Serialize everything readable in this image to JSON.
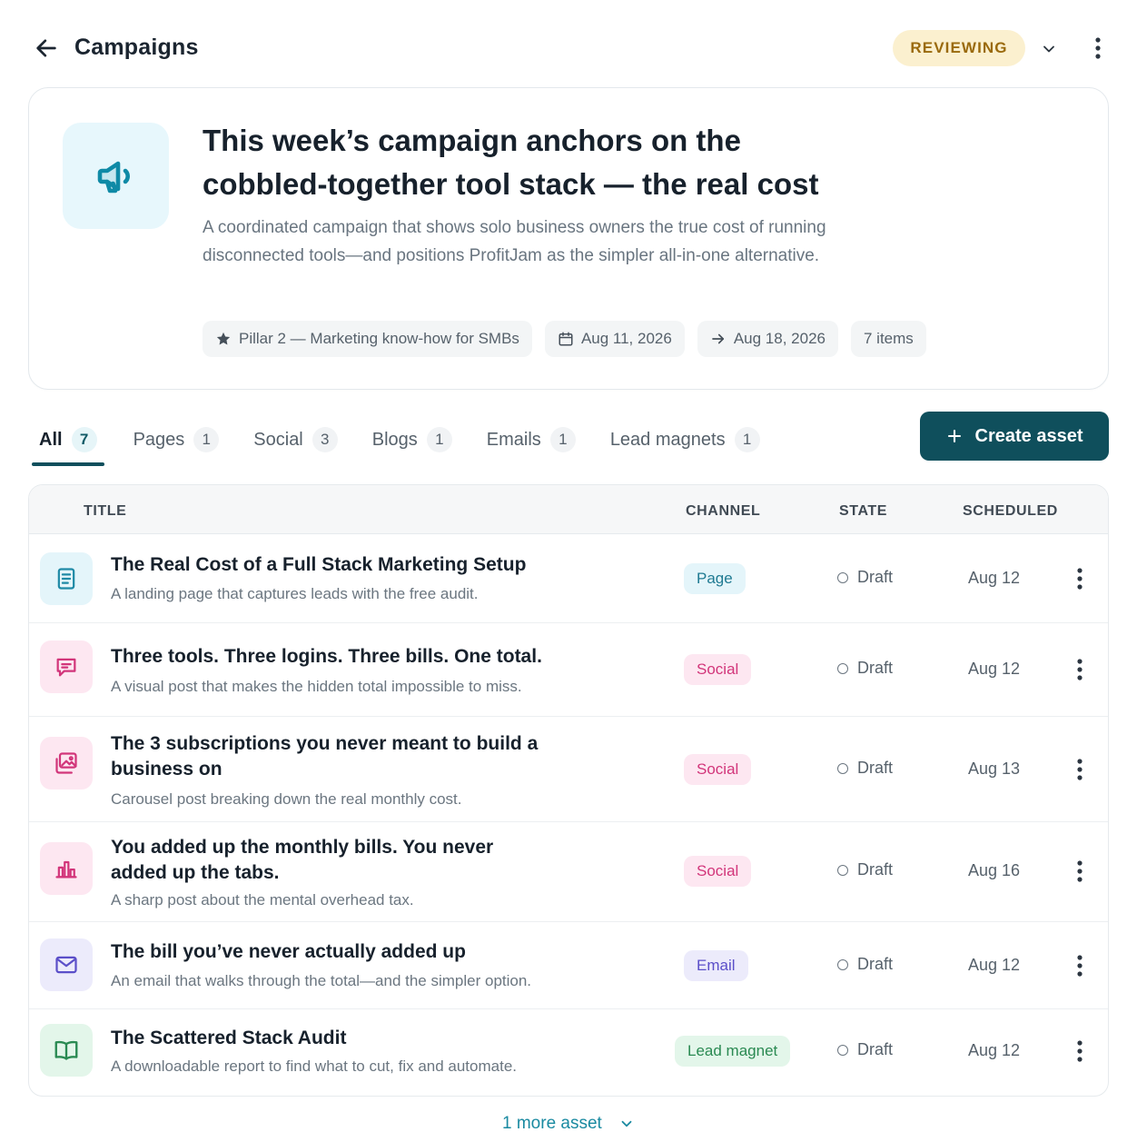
{
  "header": {
    "title": "Campaigns",
    "status": "REVIEWING"
  },
  "campaign": {
    "heading": "This week’s campaign anchors on the cobbled-together tool stack — the real cost",
    "description": "A coordinated campaign that shows solo business owners the true cost of running disconnected tools—and positions ProfitJam as the simpler all-in-one alternative.",
    "chips": {
      "pillar": "Pillar 2 — Marketing know-how for SMBs",
      "start_date": "Aug 11, 2026",
      "end_date": "Aug 18, 2026",
      "items": "7 items"
    }
  },
  "tabs": [
    {
      "label": "All",
      "count": "7"
    },
    {
      "label": "Pages",
      "count": "1"
    },
    {
      "label": "Social",
      "count": "3"
    },
    {
      "label": "Blogs",
      "count": "1"
    },
    {
      "label": "Emails",
      "count": "1"
    },
    {
      "label": "Lead magnets",
      "count": "1"
    }
  ],
  "create_button": "Create asset",
  "table": {
    "columns": {
      "title": "TITLE",
      "channel": "CHANNEL",
      "state": "STATE",
      "scheduled": "SCHEDULED"
    },
    "rows": [
      {
        "title": "The Real Cost of a Full Stack Marketing Setup",
        "subtitle": "A landing page that captures leads with the free audit.",
        "channel": "Page",
        "state": "Draft",
        "scheduled": "Aug 12",
        "icon": "document-icon"
      },
      {
        "title": "Three tools. Three logins. Three bills. One total.",
        "subtitle": "A visual post that makes the hidden total impossible to miss.",
        "channel": "Social",
        "state": "Draft",
        "scheduled": "Aug 12",
        "icon": "chat-bubble-icon"
      },
      {
        "title": "The 3 subscriptions you never meant to build a business on",
        "subtitle": "Carousel post breaking down the real monthly cost.",
        "channel": "Social",
        "state": "Draft",
        "scheduled": "Aug 13",
        "icon": "images-icon"
      },
      {
        "title": "You added up the monthly bills. You never added up the tabs.",
        "subtitle": "A sharp post about the mental overhead tax.",
        "channel": "Social",
        "state": "Draft",
        "scheduled": "Aug 16",
        "icon": "bar-chart-icon"
      },
      {
        "title": "The bill you’ve never actually added up",
        "subtitle": "An email that walks through the total—and the simpler option.",
        "channel": "Email",
        "state": "Draft",
        "scheduled": "Aug 12",
        "icon": "envelope-icon"
      },
      {
        "title": "The Scattered Stack Audit",
        "subtitle": "A downloadable report to find what to cut, fix and automate.",
        "channel": "Lead magnet",
        "state": "Draft",
        "scheduled": "Aug 12",
        "icon": "book-icon"
      }
    ]
  },
  "more_link": "1 more asset",
  "colors": {
    "primary": "#0f4f5c",
    "accent_link": "#1a8aa1",
    "reviewing_bg": "#fbf0cf",
    "reviewing_text": "#9a6a0c",
    "page_pill_bg": "#e4f5fa",
    "page_pill_text": "#1f7a92",
    "social_pill_bg": "#fde7f1",
    "social_pill_text": "#d2357a",
    "email_pill_bg": "#ecebfb",
    "email_pill_text": "#5b4fc9",
    "lead_pill_bg": "#e3f6ea",
    "lead_pill_text": "#2a8a52"
  }
}
